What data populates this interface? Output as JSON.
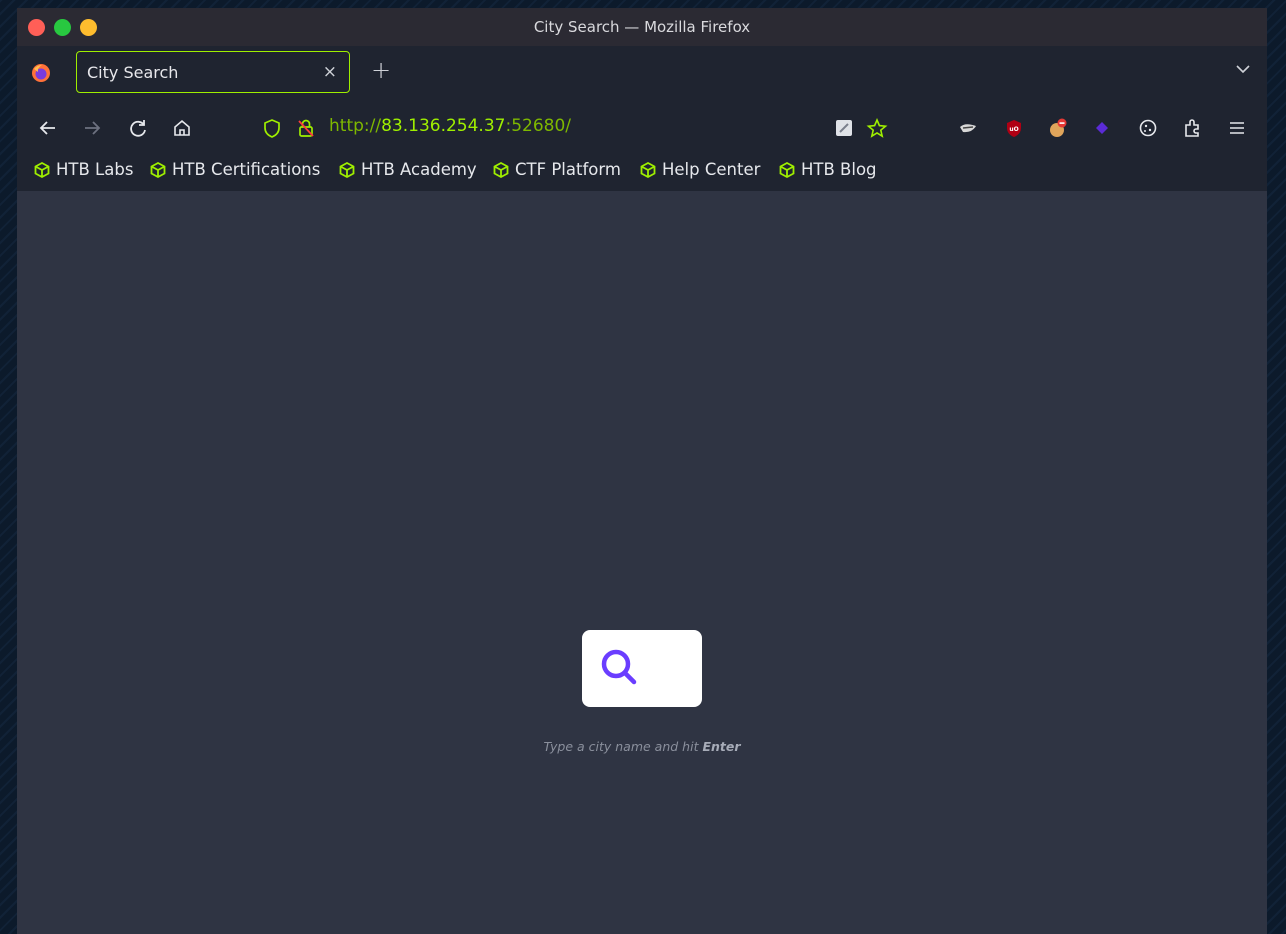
{
  "window": {
    "title": "City Search — Mozilla Firefox"
  },
  "tab": {
    "label": "City Search",
    "close_symbol": "×",
    "new_tab_symbol": "+"
  },
  "address": {
    "scheme": "http://",
    "host": "83.136.254.37",
    "port": ":52680/"
  },
  "bookmarks": [
    {
      "label": "HTB Labs"
    },
    {
      "label": "HTB Certifications"
    },
    {
      "label": "HTB Academy"
    },
    {
      "label": "CTF Platform"
    },
    {
      "label": "Help Center"
    },
    {
      "label": "HTB Blog"
    }
  ],
  "page": {
    "hint_text": "Type a city name and hit",
    "hint_key": "Enter"
  },
  "icons": [
    "firefox-icon",
    "back-icon",
    "forward-icon",
    "reload-icon",
    "home-icon",
    "shield-icon",
    "insecure-lock-icon",
    "reader-icon",
    "star-icon",
    "extension-icons",
    "puzzle-icon",
    "menu-icon",
    "search-icon"
  ],
  "colors": {
    "accent": "#9fef00",
    "search_icon": "#6a3dff"
  }
}
